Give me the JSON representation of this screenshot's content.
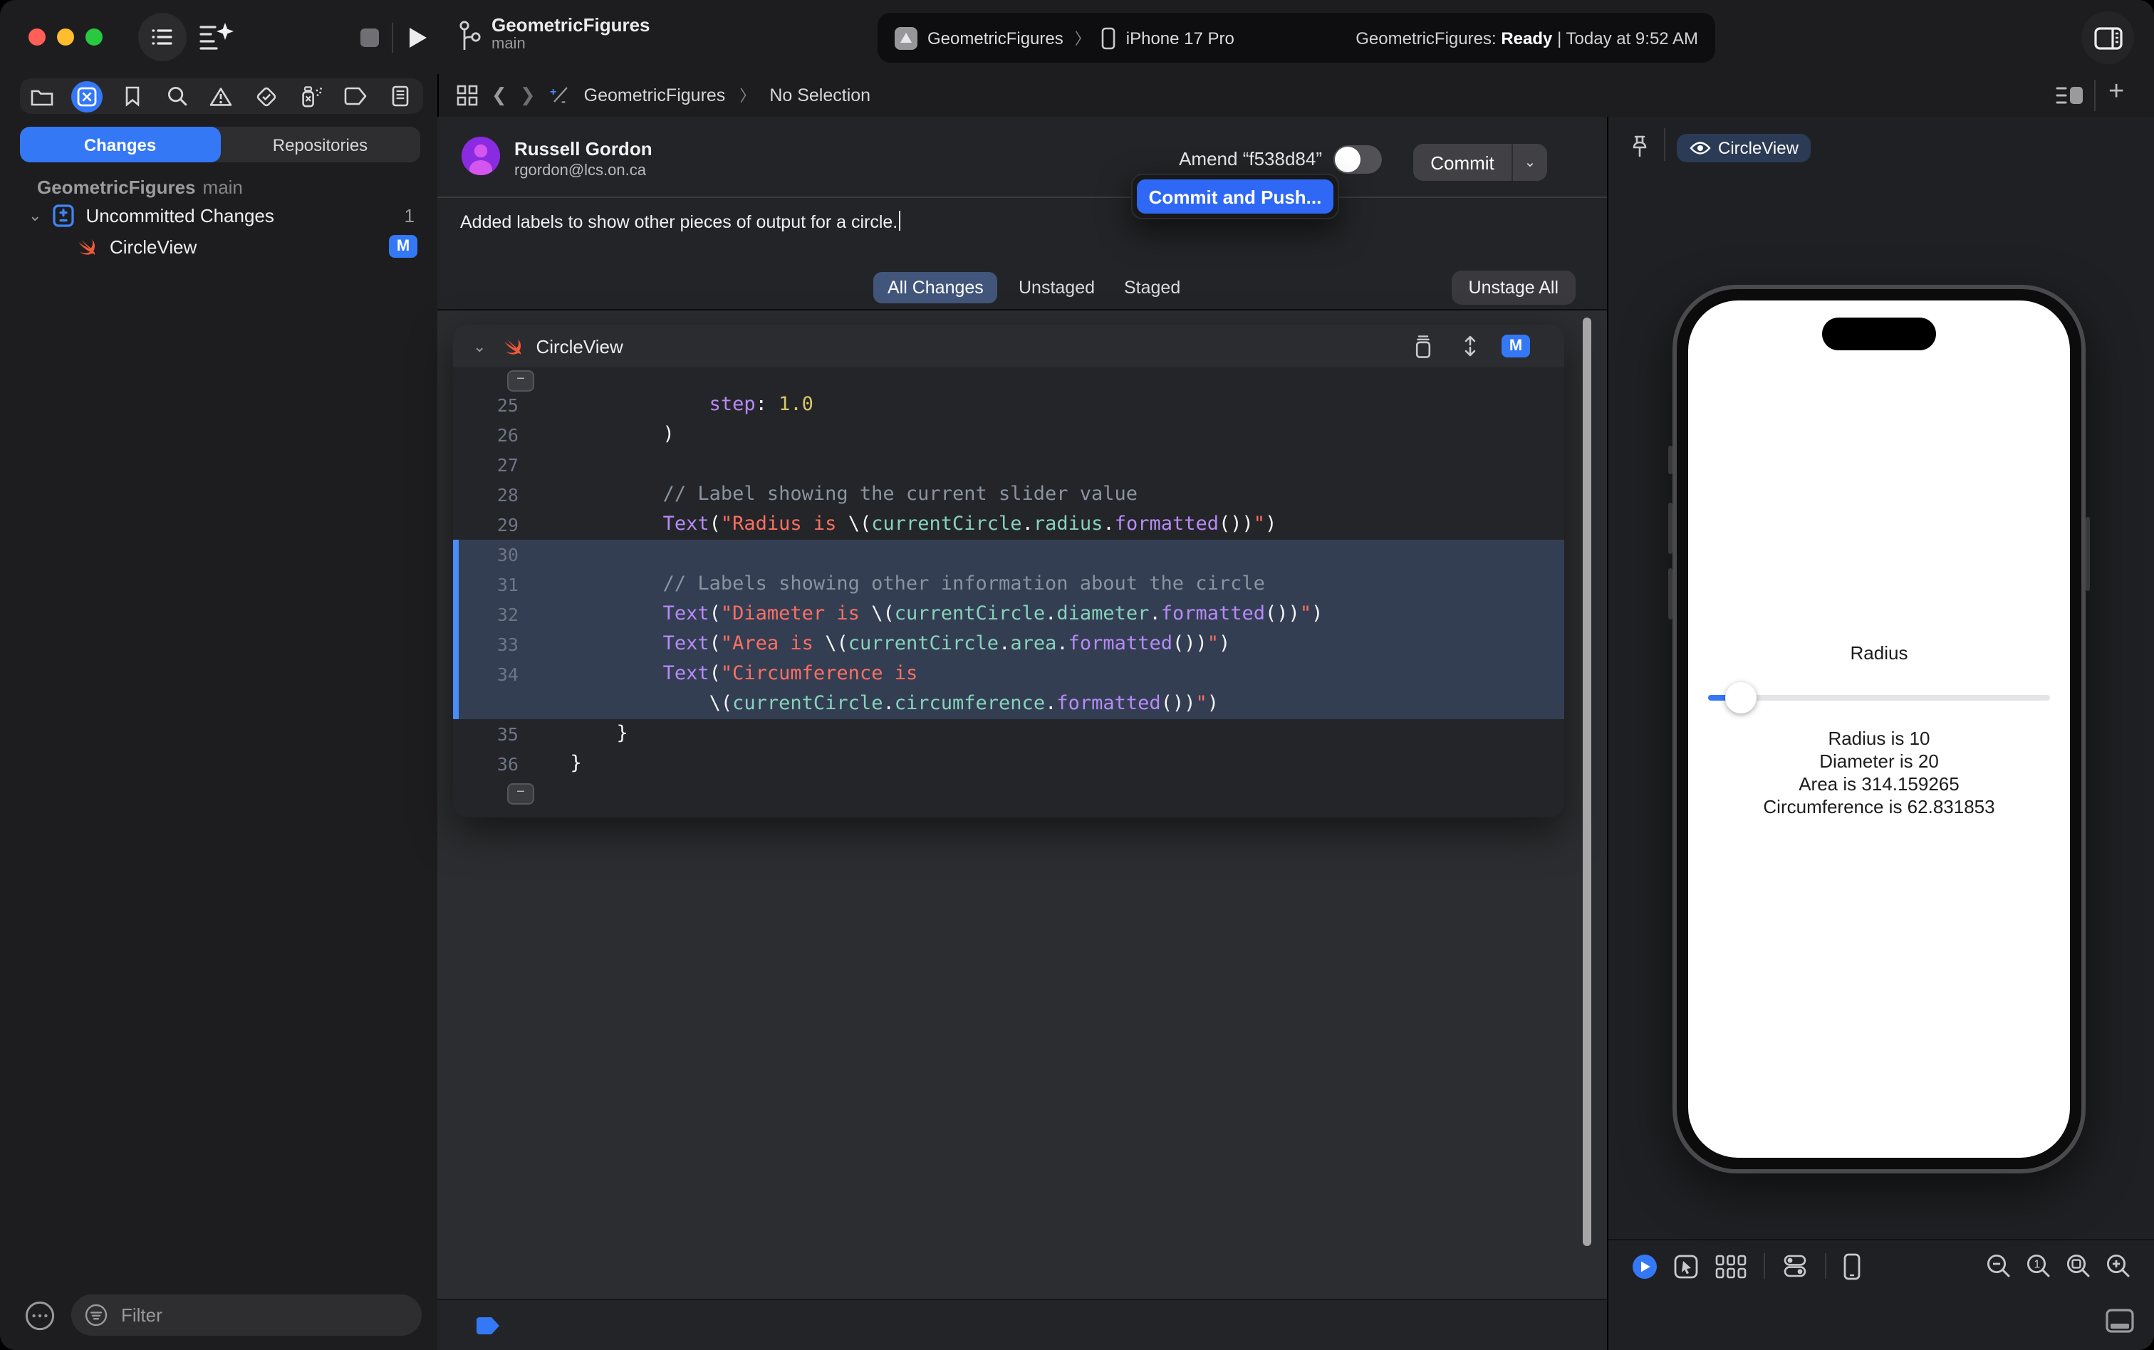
{
  "colors": {
    "accent": "#3478f6",
    "swift_orange": "#f0583c",
    "diff_highlight": "#333e53",
    "diff_bar": "#4a8cf8",
    "string": "#fc6f62",
    "number": "#d9c668",
    "comment": "#8a93a0",
    "purple": "#b78af7",
    "teal": "#86d3ba"
  },
  "titlebar": {
    "project": "GeometricFigures",
    "branch": "main",
    "activity": {
      "app": "GeometricFigures",
      "separator": "〉",
      "device": "iPhone 17 Pro",
      "status_project": "GeometricFigures:",
      "status_state": "Ready",
      "status_time": "| Today at 9:52 AM"
    }
  },
  "jumpbar": {
    "project": "GeometricFigures",
    "separator": "〉",
    "selection": "No Selection"
  },
  "sidebar": {
    "tabs": {
      "changes": "Changes",
      "repositories": "Repositories"
    },
    "repo": {
      "name": "GeometricFigures",
      "branch": "main"
    },
    "tree": [
      {
        "label": "Uncommitted Changes",
        "count": "1"
      },
      {
        "label": "CircleView",
        "badge": "M"
      }
    ],
    "filter": {
      "placeholder": "Filter"
    }
  },
  "commit": {
    "author": "Russell Gordon",
    "email": "rgordon@lcs.on.ca",
    "amend": "Amend “f538d84”",
    "button": "Commit",
    "dropdown_chevron": "⌄",
    "menu_item": "Commit and Push...",
    "message": "Added labels to show other pieces of output for a circle.",
    "tabs": [
      "All Changes",
      "Unstaged",
      "Staged"
    ],
    "unstage_all": "Unstage All"
  },
  "diff": {
    "file": "CircleView",
    "badge": "M",
    "lines": [
      {
        "n": "25",
        "hl": false,
        "t": [
          [
            "              ",
            "w"
          ],
          [
            "step",
            "p"
          ],
          [
            ": ",
            "w"
          ],
          [
            "1.0",
            "y"
          ]
        ]
      },
      {
        "n": "26",
        "hl": false,
        "t": [
          [
            "          )",
            "w"
          ]
        ]
      },
      {
        "n": "27",
        "hl": false,
        "t": []
      },
      {
        "n": "28",
        "hl": false,
        "t": [
          [
            "          ",
            "w"
          ],
          [
            "// Label showing the current slider value",
            "c"
          ]
        ]
      },
      {
        "n": "29",
        "hl": false,
        "t": [
          [
            "          ",
            "w"
          ],
          [
            "Text",
            "p"
          ],
          [
            "(",
            "w"
          ],
          [
            "\"Radius is ",
            "r"
          ],
          [
            "\\(",
            "w"
          ],
          [
            "currentCircle",
            "t"
          ],
          [
            ".",
            "w"
          ],
          [
            "radius",
            "t"
          ],
          [
            ".",
            "w"
          ],
          [
            "formatted",
            "p"
          ],
          [
            "())",
            "w"
          ],
          [
            "\"",
            "r"
          ],
          [
            ")",
            "w"
          ]
        ]
      },
      {
        "n": "30",
        "hl": true,
        "t": []
      },
      {
        "n": "31",
        "hl": true,
        "t": [
          [
            "          ",
            "w"
          ],
          [
            "// Labels showing other information about the circle",
            "c"
          ]
        ]
      },
      {
        "n": "32",
        "hl": true,
        "t": [
          [
            "          ",
            "w"
          ],
          [
            "Text",
            "p"
          ],
          [
            "(",
            "w"
          ],
          [
            "\"Diameter is ",
            "r"
          ],
          [
            "\\(",
            "w"
          ],
          [
            "currentCircle",
            "t"
          ],
          [
            ".",
            "w"
          ],
          [
            "diameter",
            "t"
          ],
          [
            ".",
            "w"
          ],
          [
            "formatted",
            "p"
          ],
          [
            "())",
            "w"
          ],
          [
            "\"",
            "r"
          ],
          [
            ")",
            "w"
          ]
        ]
      },
      {
        "n": "33",
        "hl": true,
        "t": [
          [
            "          ",
            "w"
          ],
          [
            "Text",
            "p"
          ],
          [
            "(",
            "w"
          ],
          [
            "\"Area is ",
            "r"
          ],
          [
            "\\(",
            "w"
          ],
          [
            "currentCircle",
            "t"
          ],
          [
            ".",
            "w"
          ],
          [
            "area",
            "t"
          ],
          [
            ".",
            "w"
          ],
          [
            "formatted",
            "p"
          ],
          [
            "())",
            "w"
          ],
          [
            "\"",
            "r"
          ],
          [
            ")",
            "w"
          ]
        ]
      },
      {
        "n": "34",
        "hl": true,
        "t": [
          [
            "          ",
            "w"
          ],
          [
            "Text",
            "p"
          ],
          [
            "(",
            "w"
          ],
          [
            "\"Circumference is",
            "r"
          ]
        ]
      },
      {
        "n": "",
        "hl": true,
        "t": [
          [
            "              ",
            "w"
          ],
          [
            "\\(",
            "w"
          ],
          [
            "currentCircle",
            "t"
          ],
          [
            ".",
            "w"
          ],
          [
            "circumference",
            "t"
          ],
          [
            ".",
            "w"
          ],
          [
            "formatted",
            "p"
          ],
          [
            "())",
            "w"
          ],
          [
            "\"",
            "r"
          ],
          [
            ")",
            "w"
          ]
        ]
      },
      {
        "n": "35",
        "hl": false,
        "t": [
          [
            "      }",
            "w"
          ]
        ]
      },
      {
        "n": "36",
        "hl": false,
        "t": [
          [
            "  }",
            "w"
          ]
        ]
      }
    ]
  },
  "canvas": {
    "pill": "CircleView",
    "phone": {
      "slider_label": "Radius",
      "slider_fill_percent": 8,
      "labels": [
        "Radius is 10",
        "Diameter is 20",
        "Area is 314.159265",
        "Circumference is 62.831853"
      ]
    }
  }
}
